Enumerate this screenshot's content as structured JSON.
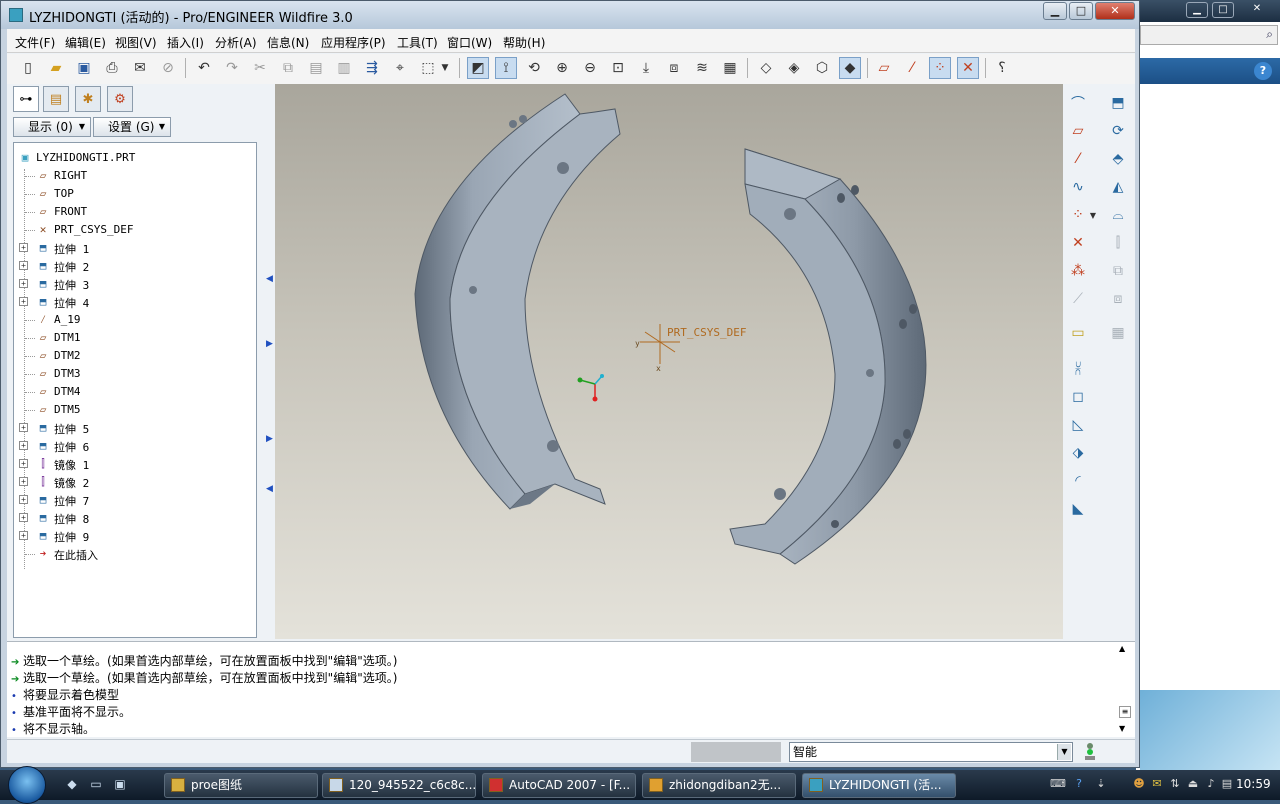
{
  "window": {
    "title": "LYZHIDONGTI (活动的) - Pro/ENGINEER Wildfire 3.0",
    "min": "▁",
    "max": "□",
    "close": "✕"
  },
  "menu": [
    "文件(F)",
    "编辑(E)",
    "视图(V)",
    "插入(I)",
    "分析(A)",
    "信息(N)",
    "应用程序(P)",
    "工具(T)",
    "窗口(W)",
    "帮助(H)"
  ],
  "model_tree": {
    "show_label": "显示 (0)",
    "settings_label": "设置 (G)",
    "items": [
      {
        "label": "LYZHIDONGTI.PRT",
        "icon": "part-icon",
        "expand": false
      },
      {
        "label": "RIGHT",
        "icon": "datum-plane-icon",
        "expand": false
      },
      {
        "label": "TOP",
        "icon": "datum-plane-icon",
        "expand": false
      },
      {
        "label": "FRONT",
        "icon": "datum-plane-icon",
        "expand": false
      },
      {
        "label": "PRT_CSYS_DEF",
        "icon": "csys-icon",
        "expand": false
      },
      {
        "label": "拉伸 1",
        "icon": "extrude-icon",
        "expand": true
      },
      {
        "label": "拉伸 2",
        "icon": "extrude-icon",
        "expand": true
      },
      {
        "label": "拉伸 3",
        "icon": "extrude-icon",
        "expand": true
      },
      {
        "label": "拉伸 4",
        "icon": "extrude-icon",
        "expand": true
      },
      {
        "label": "A_19",
        "icon": "datum-axis-icon",
        "expand": false
      },
      {
        "label": "DTM1",
        "icon": "datum-plane-icon",
        "expand": false
      },
      {
        "label": "DTM2",
        "icon": "datum-plane-icon",
        "expand": false
      },
      {
        "label": "DTM3",
        "icon": "datum-plane-icon",
        "expand": false
      },
      {
        "label": "DTM4",
        "icon": "datum-plane-icon",
        "expand": false
      },
      {
        "label": "DTM5",
        "icon": "datum-plane-icon",
        "expand": false
      },
      {
        "label": "拉伸 5",
        "icon": "extrude-icon",
        "expand": true
      },
      {
        "label": "拉伸 6",
        "icon": "extrude-icon",
        "expand": true
      },
      {
        "label": "镜像 1",
        "icon": "mirror-icon",
        "expand": true
      },
      {
        "label": "镜像 2",
        "icon": "mirror-icon",
        "expand": true
      },
      {
        "label": "拉伸 7",
        "icon": "extrude-icon",
        "expand": true
      },
      {
        "label": "拉伸 8",
        "icon": "extrude-icon",
        "expand": true
      },
      {
        "label": "拉伸 9",
        "icon": "extrude-icon",
        "expand": true
      },
      {
        "label": "在此插入",
        "icon": "insert-here-icon",
        "expand": false
      }
    ]
  },
  "viewport": {
    "csys_label": "PRT_CSYS_DEF",
    "csys_x": "x",
    "csys_y": "y",
    "part_color": "#8e9aa8",
    "part_dark": "#5d6977",
    "part_light": "#b4bfcb"
  },
  "messages": [
    {
      "type": "prompt",
      "text": "选取一个草绘。(如果首选内部草绘，可在放置面板中找到\"编辑\"选项。)"
    },
    {
      "type": "prompt",
      "text": "选取一个草绘。(如果首选内部草绘，可在放置面板中找到\"编辑\"选项。)"
    },
    {
      "type": "info",
      "text": "将要显示着色模型"
    },
    {
      "type": "info",
      "text": "基准平面将不显示。"
    },
    {
      "type": "info",
      "text": "将不显示轴。"
    }
  ],
  "status": {
    "filter_value": "智能"
  },
  "taskbar": {
    "tasks": [
      {
        "label": "proe图纸",
        "active": false
      },
      {
        "label": "120_945522_c6c8c...",
        "active": false
      },
      {
        "label": "AutoCAD 2007 - [F...",
        "active": false
      },
      {
        "label": "zhidongdiban2无...",
        "active": false
      },
      {
        "label": "LYZHIDONGTI (活...",
        "active": true
      }
    ],
    "clock": "10:59"
  },
  "colors": {
    "accent": "#2a6aa0",
    "prompt_green": "#0a8a20",
    "info_blue": "#1a3ab0"
  }
}
